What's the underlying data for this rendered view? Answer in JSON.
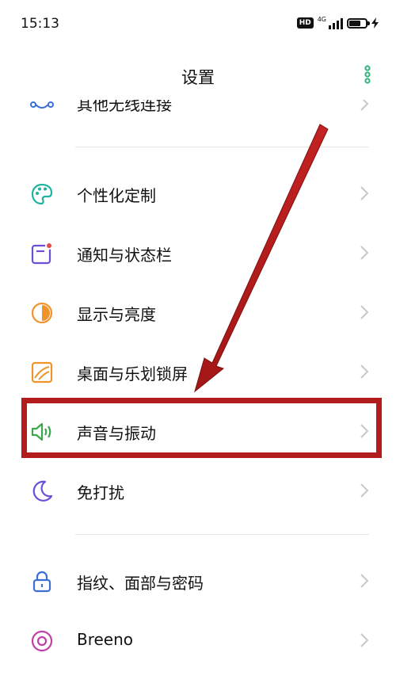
{
  "status_bar": {
    "time": "15:13",
    "hd_label": "HD",
    "network_label": "4G"
  },
  "header": {
    "title": "设置"
  },
  "colors": {
    "accent": "#2db37a",
    "highlight": "#b31c1c",
    "arrow": "#b31c1c"
  },
  "settings": {
    "other_wireless": {
      "label": "其他无线连接",
      "icon": "connections-icon"
    },
    "personalize": {
      "label": "个性化定制",
      "icon": "palette-icon"
    },
    "notifications": {
      "label": "通知与状态栏",
      "icon": "notification-icon"
    },
    "display": {
      "label": "显示与亮度",
      "icon": "brightness-icon"
    },
    "home": {
      "label": "桌面与乐划锁屏",
      "icon": "wallpaper-icon"
    },
    "sound": {
      "label": "声音与振动",
      "icon": "speaker-icon"
    },
    "dnd": {
      "label": "免打扰",
      "icon": "moon-icon"
    },
    "security": {
      "label": "指纹、面部与密码",
      "icon": "lock-icon"
    },
    "breeno": {
      "label": "Breeno",
      "icon": "breeno-icon"
    }
  }
}
